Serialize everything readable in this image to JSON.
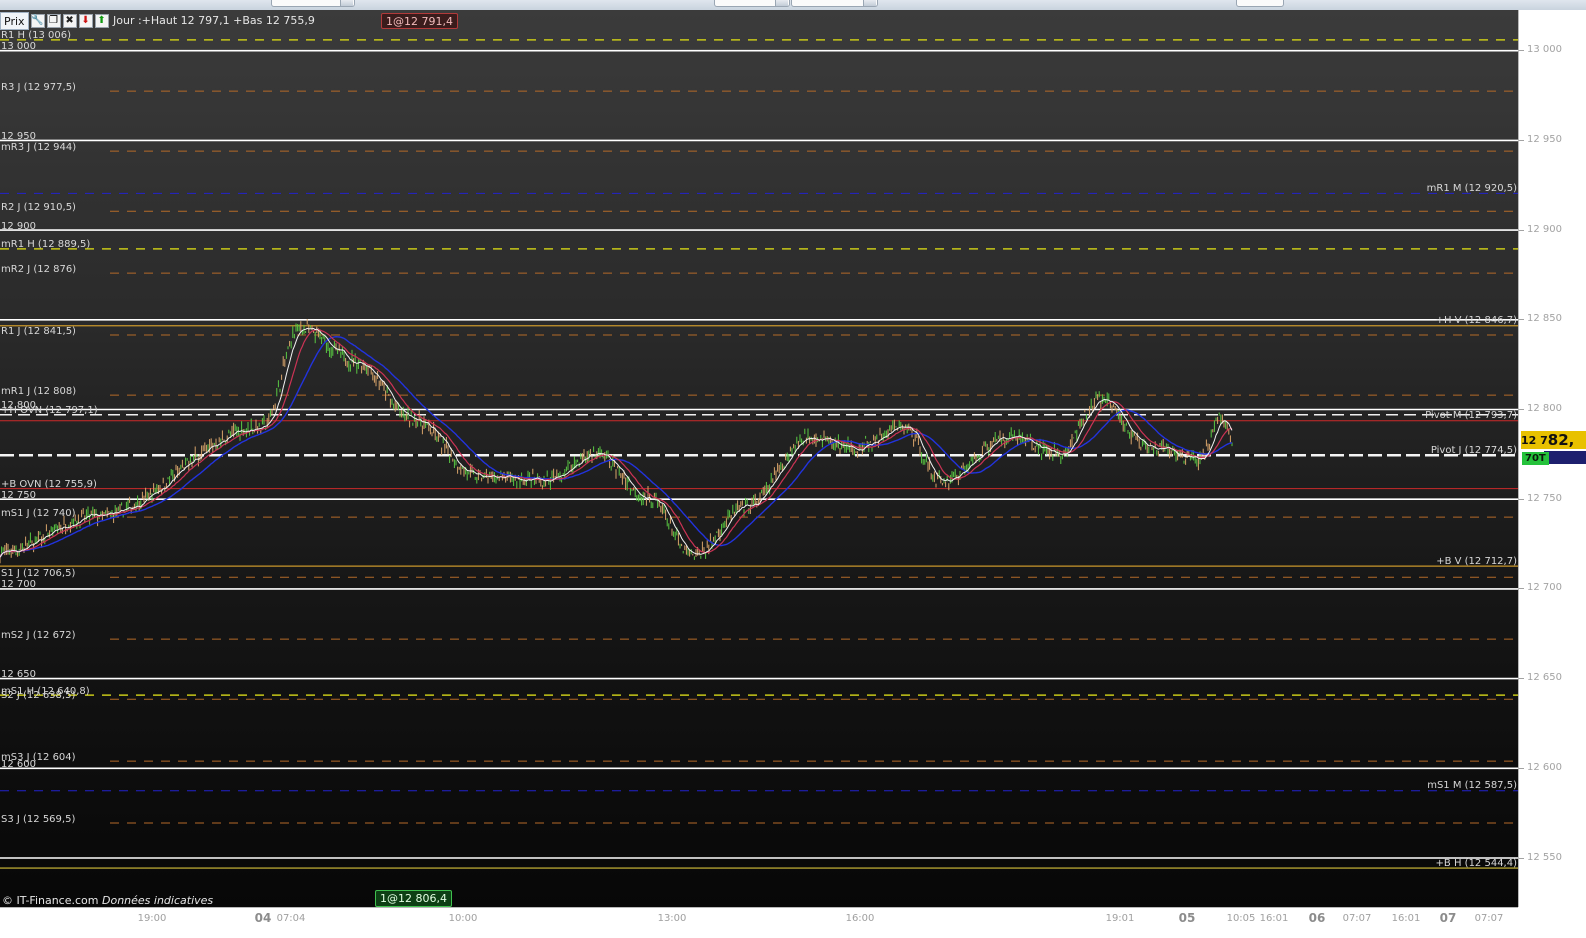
{
  "toolbar": {
    "chart_button_label": "Prix",
    "day_info": "Jour :+Haut 12 797,1 +Bas 12 755,9",
    "icons": [
      "properties-icon",
      "restore-window-icon",
      "close-circle-icon",
      "arrow-down-red-icon",
      "arrow-up-green-icon"
    ]
  },
  "orders": {
    "top": "1@12 791,4",
    "bottom": "1@12 806,4"
  },
  "copyright": {
    "brand": "© IT-Finance.com",
    "note": "Données indicatives"
  },
  "price_axis": {
    "labels": [
      "13 000",
      "12 950",
      "12 900",
      "12 850",
      "12 800",
      "12 750",
      "12 700",
      "12 650",
      "12 600",
      "12 550"
    ],
    "values": [
      13000,
      12950,
      12900,
      12850,
      12800,
      12750,
      12700,
      12650,
      12600,
      12550
    ]
  },
  "time_axis": {
    "labels": [
      {
        "text": "19:00",
        "big": false
      },
      {
        "text": "04",
        "big": true
      },
      {
        "text": "07:04",
        "big": false
      },
      {
        "text": "10:00",
        "big": false
      },
      {
        "text": "13:00",
        "big": false
      },
      {
        "text": "16:00",
        "big": false
      },
      {
        "text": "19:01",
        "big": false
      },
      {
        "text": "05",
        "big": true
      },
      {
        "text": "10:05",
        "big": false
      },
      {
        "text": "16:01",
        "big": false
      },
      {
        "text": "06",
        "big": true
      },
      {
        "text": "07:07",
        "big": false
      },
      {
        "text": "16:01",
        "big": false
      },
      {
        "text": "07",
        "big": true
      },
      {
        "text": "07:07",
        "big": false
      }
    ]
  },
  "current_price": {
    "prefix": "12 7",
    "big": "82,",
    "volume_badge": "70T"
  },
  "colors": {
    "yellow_dash": "#c8c818",
    "orange_dash": "#b46a28",
    "blue_dash": "#2222cc",
    "white_round": "#ffffff",
    "orange_solid": "#c8962a",
    "red_solid": "#cc2a2a",
    "candle_up": "#59c843",
    "candle_down": "#d8a46a",
    "ma_blue": "#2233dd",
    "ma_red": "#cc3355",
    "ma_white": "#f2f2f2"
  },
  "levels": {
    "left": [
      {
        "text": "R1 H (13 006)",
        "price": 13006,
        "style": "yellow"
      },
      {
        "text": "13 000",
        "price": 13000,
        "style": "white"
      },
      {
        "text": "R3 J (12 977,5)",
        "price": 12977.5,
        "style": "orange"
      },
      {
        "text": "12 950",
        "price": 12950,
        "style": "white"
      },
      {
        "text": "mR3 J (12 944)",
        "price": 12944,
        "style": "orange"
      },
      {
        "text": "R2 J (12 910,5)",
        "price": 12910.5,
        "style": "orange"
      },
      {
        "text": "12 900",
        "price": 12900,
        "style": "white"
      },
      {
        "text": "mR1 H (12 889,5)",
        "price": 12889.5,
        "style": "yellow"
      },
      {
        "text": "mR2 J (12 876)",
        "price": 12876,
        "style": "orange"
      },
      {
        "text": "R1 J (12 841,5)",
        "price": 12841.5,
        "style": "orange"
      },
      {
        "text": "mR1 J (12 808)",
        "price": 12808,
        "style": "orange"
      },
      {
        "text": "12 800",
        "price": 12800,
        "style": "white"
      },
      {
        "text": "+H OVN (12 797,1)",
        "price": 12797.1,
        "style": "white"
      },
      {
        "text": "+B OVN (12 755,9)",
        "price": 12755.9,
        "style": "red"
      },
      {
        "text": "12 750",
        "price": 12750,
        "style": "white"
      },
      {
        "text": "mS1 J (12 740)",
        "price": 12740,
        "style": "orange"
      },
      {
        "text": "S1 J (12 706,5)",
        "price": 12706.5,
        "style": "orange"
      },
      {
        "text": "12 700",
        "price": 12700,
        "style": "white"
      },
      {
        "text": "mS2 J (12 672)",
        "price": 12672,
        "style": "orange"
      },
      {
        "text": "12 650",
        "price": 12650,
        "style": "white"
      },
      {
        "text": "mS1 H (12 640,8)",
        "price": 12640.8,
        "style": "yellow"
      },
      {
        "text": "S2 J (12 638,5)",
        "price": 12638.5,
        "style": "orange"
      },
      {
        "text": "mS3 J (12 604)",
        "price": 12604,
        "style": "orange"
      },
      {
        "text": "12 600",
        "price": 12600,
        "style": "white"
      },
      {
        "text": "S3 J (12 569,5)",
        "price": 12569.5,
        "style": "orange"
      }
    ],
    "right": [
      {
        "text": "mR1 M (12 920,5)",
        "price": 12920.5,
        "style": "blue"
      },
      {
        "text": "+H V (12 846,7)",
        "price": 12846.7,
        "style": "orange-solid"
      },
      {
        "text": "Pivot M (12 793,7)",
        "price": 12793.7,
        "style": "red-solid"
      },
      {
        "text": "Pivot J (12 774,5)",
        "price": 12774.5,
        "style": "white-dash"
      },
      {
        "text": "+B V (12 712,7)",
        "price": 12712.7,
        "style": "orange-solid"
      },
      {
        "text": "mS1 M (12 587,5)",
        "price": 12587.5,
        "style": "blue"
      },
      {
        "text": "+B H (12 544,4)",
        "price": 12544.4,
        "style": "yellow-solid"
      }
    ]
  },
  "chart_data": {
    "type": "line",
    "title": "",
    "xlabel": "",
    "ylabel": "",
    "ylim": [
      12545,
      13006
    ],
    "x": [
      "19:00",
      "07:04",
      "10:00",
      "13:00",
      "16:00",
      "19:01",
      "10:05"
    ],
    "series": [
      {
        "values": [
          12720,
          12740,
          12790,
          12845,
          12826,
          12795,
          12762,
          12760,
          12775,
          12750,
          12718,
          12745,
          12785,
          12778,
          12790,
          12760,
          12785,
          12775,
          12805,
          12778,
          12772,
          12795,
          12782
        ]
      }
    ]
  }
}
